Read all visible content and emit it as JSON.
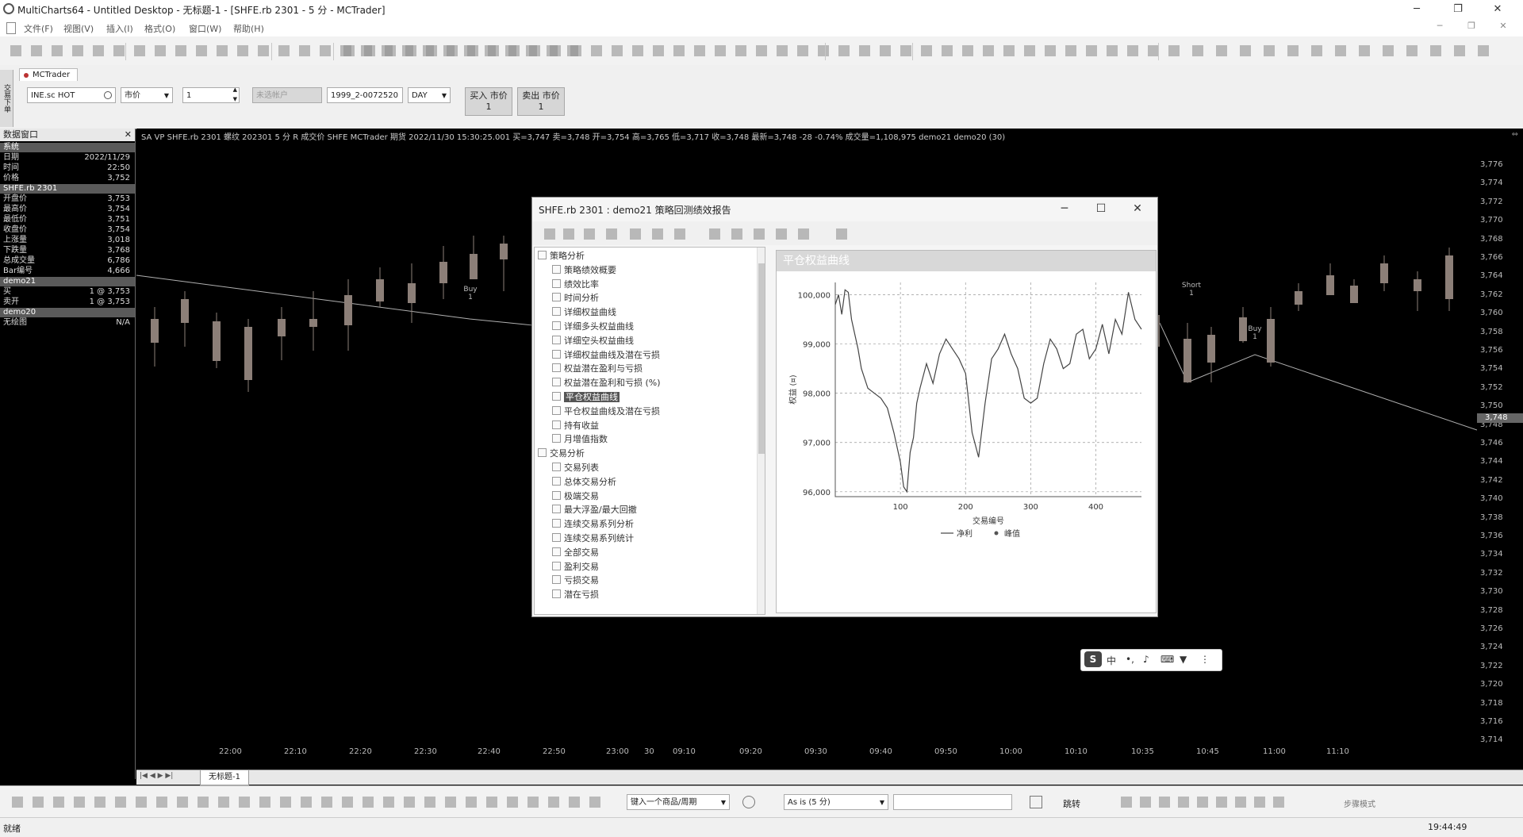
{
  "window": {
    "title": "MultiCharts64 - Untitled Desktop - 无标题-1 - [SHFE.rb 2301 - 5 分 - MCTrader]",
    "menu": [
      "文件(F)",
      "视图(V)",
      "插入(I)",
      "格式(O)",
      "窗口(W)",
      "帮助(H)"
    ]
  },
  "order_bar": {
    "tab_label": "MCTrader",
    "side_label": "交易下单",
    "symbol": "INE.sc HOT",
    "order_type": "市价",
    "quantity": "1",
    "account": "未选帐户",
    "account_id": "1999_2-0072520",
    "period": "DAY",
    "buy_label": "买入 市价",
    "buy_qty": "1",
    "sell_label": "卖出 市价",
    "sell_qty": "1"
  },
  "data_window": {
    "title": "数据窗口",
    "rows": [
      {
        "k": "系统",
        "v": "",
        "sec": true
      },
      {
        "k": "日期",
        "v": "2022/11/29"
      },
      {
        "k": "时间",
        "v": "22:50"
      },
      {
        "k": "价格",
        "v": "3,752"
      },
      {
        "k": "SHFE.rb 2301",
        "v": "",
        "sec": true
      },
      {
        "k": "开盘价",
        "v": "3,753"
      },
      {
        "k": "最高价",
        "v": "3,754"
      },
      {
        "k": "最低价",
        "v": "3,751"
      },
      {
        "k": "收盘价",
        "v": "3,754"
      },
      {
        "k": "上涨量",
        "v": "3,018"
      },
      {
        "k": "下跌量",
        "v": "3,768"
      },
      {
        "k": "总成交量",
        "v": "6,786"
      },
      {
        "k": "Bar编号",
        "v": "4,666"
      },
      {
        "k": "demo21",
        "v": "",
        "sec": true
      },
      {
        "k": "买",
        "v": "1 @ 3,753"
      },
      {
        "k": "卖开",
        "v": "1 @ 3,753"
      },
      {
        "k": "demo20",
        "v": "",
        "sec": true
      },
      {
        "k": "无绘图",
        "v": "N/A"
      }
    ]
  },
  "chart": {
    "info_line": "SA  VP  SHFE.rb 2301  螺纹 202301 5 分  R  成交价 SHFE MCTrader 期货 2022/11/30 15:30:25.001 买=3,747 卖=3,748 开=3,754 高=3,765 低=3,717 收=3,748 最新=3,748 -28 -0.74% 成交量=1,108,975 demo21  demo20 (30)",
    "price_labels": [
      "3,776",
      "3,774",
      "3,772",
      "3,770",
      "3,768",
      "3,766",
      "3,764",
      "3,762",
      "3,760",
      "3,758",
      "3,756",
      "3,754",
      "3,752",
      "3,750",
      "3,748",
      "3,746",
      "3,744",
      "3,742",
      "3,740",
      "3,738",
      "3,736",
      "3,734",
      "3,732",
      "3,730",
      "3,728",
      "3,726",
      "3,724",
      "3,722",
      "3,720",
      "3,718",
      "3,716",
      "3,714"
    ],
    "current_price": "3,748",
    "time_labels": [
      "22:00",
      "22:10",
      "22:20",
      "22:30",
      "22:40",
      "22:50",
      "23:00",
      "30",
      "09:10",
      "09:20",
      "09:30",
      "09:40",
      "09:50",
      "10:00",
      "10:10",
      "10:35",
      "10:45",
      "11:00",
      "11:10"
    ],
    "markers": [
      {
        "label": "Buy",
        "qty": "1"
      },
      {
        "label": "Short",
        "qty": "1"
      },
      {
        "label": "Buy",
        "qty": "1"
      }
    ],
    "colors": {
      "candle": "#8c7f78",
      "trade_line": "#b0b0b0"
    }
  },
  "sheet_tab": "无标题-1",
  "draw_bar": {
    "symbol_input": "键入一个商品/周期",
    "resolution": "As is (5 分)",
    "jump_label": "跳转",
    "mode_label": "步骤模式"
  },
  "status": {
    "left": "就绪",
    "time": "19:44:49"
  },
  "report": {
    "title": "SHFE.rb 2301 : demo21 策略回测绩效报告",
    "tree": [
      {
        "label": "策略分析",
        "group": true
      },
      {
        "label": "策略绩效概要"
      },
      {
        "label": "绩效比率"
      },
      {
        "label": "时间分析"
      },
      {
        "label": "详细权益曲线"
      },
      {
        "label": "详细多头权益曲线"
      },
      {
        "label": "详细空头权益曲线"
      },
      {
        "label": "详细权益曲线及潜在亏损"
      },
      {
        "label": "权益潜在盈利与亏损"
      },
      {
        "label": "权益潜在盈利和亏损 (%)"
      },
      {
        "label": "平仓权益曲线",
        "selected": true
      },
      {
        "label": "平仓权益曲线及潜在亏损"
      },
      {
        "label": "持有收益"
      },
      {
        "label": "月增值指数"
      },
      {
        "label": "交易分析",
        "group": true
      },
      {
        "label": "交易列表"
      },
      {
        "label": "总体交易分析"
      },
      {
        "label": "极端交易"
      },
      {
        "label": "最大浮盈/最大回撤"
      },
      {
        "label": "连续交易系列分析"
      },
      {
        "label": "连续交易系列统计"
      },
      {
        "label": "全部交易"
      },
      {
        "label": "盈利交易"
      },
      {
        "label": "亏损交易"
      },
      {
        "label": "潜在亏损"
      }
    ],
    "plot_title": "平仓权益曲线",
    "chart_data": {
      "type": "line",
      "title": "",
      "xlabel": "交易编号",
      "ylabel": "权益 (¤)",
      "xlim": [
        0,
        470
      ],
      "ylim": [
        95900,
        100250
      ],
      "x_ticks": [
        "100",
        "200",
        "300",
        "400"
      ],
      "y_ticks": [
        "96,000",
        "97,000",
        "98,000",
        "99,000",
        "100,000"
      ],
      "grid": true,
      "legend": [
        "净利",
        "峰值"
      ],
      "series": [
        {
          "name": "净利",
          "x": [
            0,
            5,
            10,
            15,
            20,
            25,
            30,
            35,
            40,
            50,
            60,
            70,
            80,
            90,
            100,
            105,
            110,
            115,
            120,
            125,
            130,
            140,
            150,
            160,
            170,
            180,
            190,
            200,
            210,
            220,
            230,
            240,
            250,
            260,
            270,
            280,
            290,
            300,
            310,
            320,
            330,
            340,
            350,
            360,
            370,
            380,
            390,
            400,
            410,
            420,
            430,
            440,
            450,
            460,
            470
          ],
          "y": [
            99800,
            100000,
            99600,
            100100,
            100050,
            99500,
            99200,
            98900,
            98500,
            98100,
            98000,
            97900,
            97700,
            97200,
            96600,
            96100,
            96000,
            96800,
            97100,
            97800,
            98100,
            98600,
            98200,
            98800,
            99100,
            98900,
            98700,
            98400,
            97200,
            96700,
            97800,
            98700,
            98900,
            99200,
            98800,
            98500,
            97900,
            97800,
            97900,
            98600,
            99100,
            98900,
            98500,
            98600,
            99200,
            99300,
            98700,
            98900,
            99400,
            98800,
            99500,
            99200,
            100050,
            99500,
            99300
          ]
        }
      ]
    }
  }
}
